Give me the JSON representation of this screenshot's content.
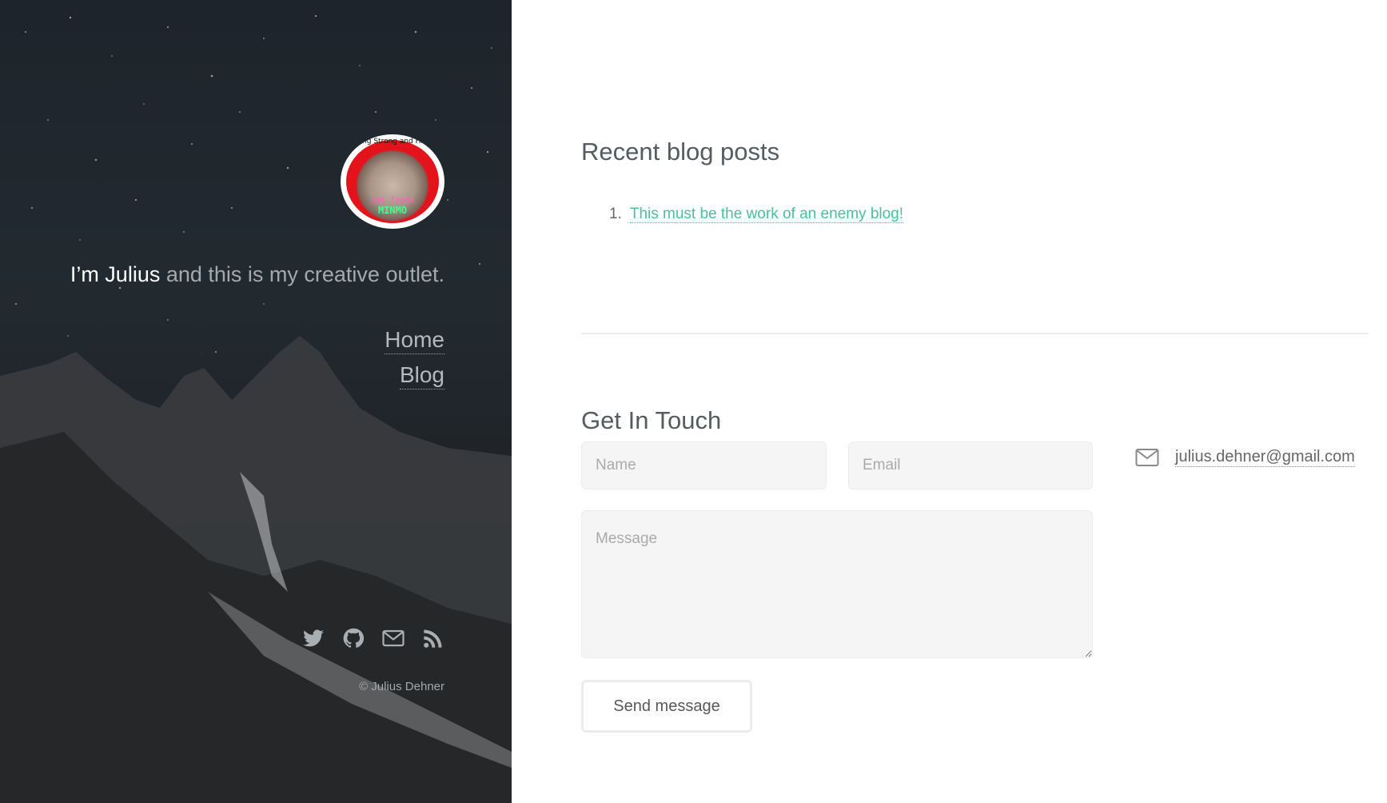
{
  "sidebar": {
    "avatar": {
      "top_text": "ng Strong and Hi",
      "mid_text": "cat foods",
      "bottom_text": "MINMO"
    },
    "tagline": {
      "name": "I’m Julius",
      "rest": " and this is my creative outlet."
    },
    "nav": [
      {
        "label": "Home"
      },
      {
        "label": "Blog"
      }
    ],
    "social_icons": [
      "twitter-icon",
      "github-icon",
      "envelope-icon",
      "rss-icon"
    ],
    "copyright": "© Julius Dehner"
  },
  "main": {
    "recent_posts": {
      "heading": "Recent blog posts",
      "items": [
        {
          "number": "1.",
          "title": "This must be the work of an enemy blog!"
        }
      ]
    },
    "contact": {
      "heading": "Get In Touch",
      "name_placeholder": "Name",
      "email_placeholder": "Email",
      "message_placeholder": "Message",
      "send_label": "Send message",
      "email_address": "julius.dehner@gmail.com",
      "email_icon": "envelope-icon"
    }
  },
  "colors": {
    "accent": "#49bf9d",
    "sidebar_bg": "#1f252b",
    "text": "#585858"
  }
}
